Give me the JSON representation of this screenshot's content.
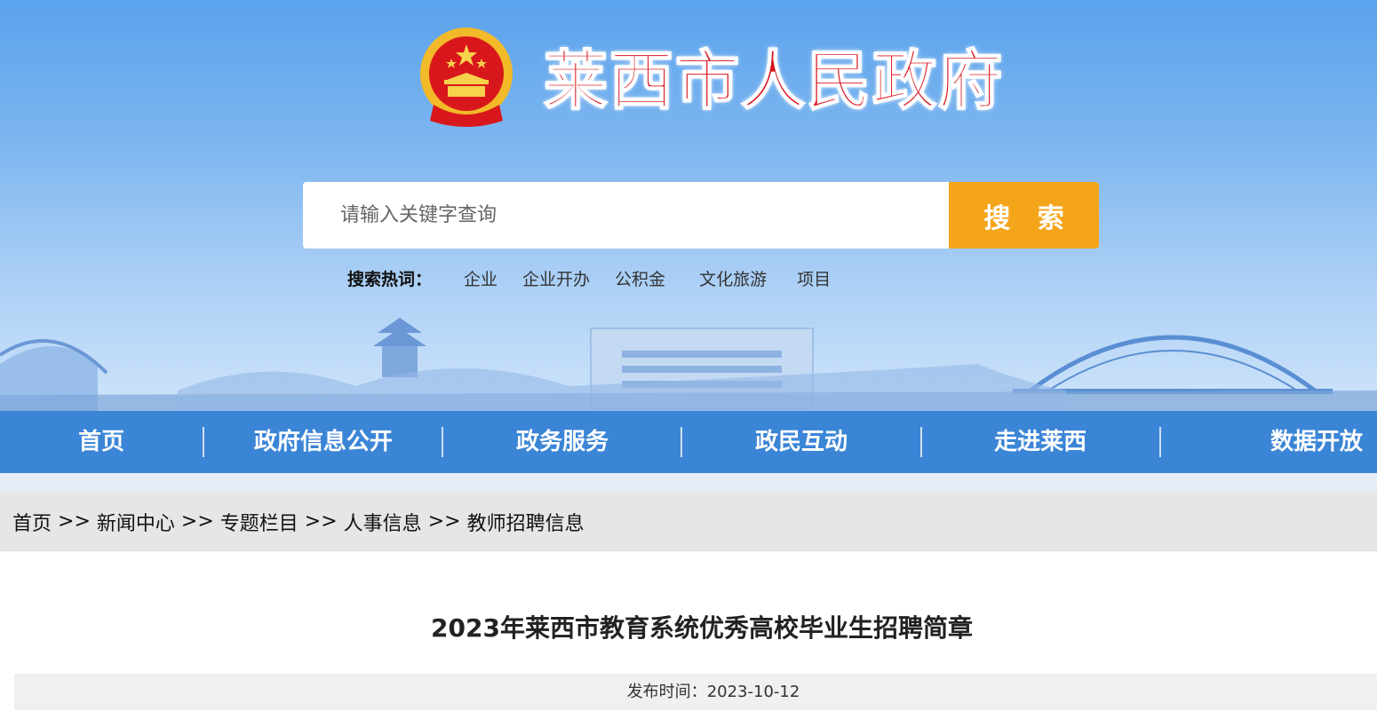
{
  "header": {
    "site_title": "莱西市人民政府",
    "emblem_icon": "national-emblem-icon",
    "search": {
      "placeholder": "请输入关键字查询",
      "button_label": "搜 索"
    },
    "hot_words": {
      "label": "搜索热词：",
      "items": [
        "企业",
        "企业开办",
        "公积金",
        "文化旅游",
        "项目"
      ]
    }
  },
  "nav": {
    "items": [
      "首页",
      "政府信息公开",
      "政务服务",
      "政民互动",
      "走进莱西",
      "数据开放"
    ]
  },
  "breadcrumb": {
    "items": [
      "首页",
      "新闻中心",
      "专题栏目",
      "人事信息",
      "教师招聘信息"
    ],
    "separator": ">>"
  },
  "article": {
    "title": "2023年莱西市教育系统优秀高校毕业生招聘简章",
    "publish_label": "发布时间：",
    "publish_date": "2023-10-12"
  },
  "colors": {
    "nav_bg": "#3b85d6",
    "search_button": "#f5a519",
    "title_red": "#d8121b"
  }
}
